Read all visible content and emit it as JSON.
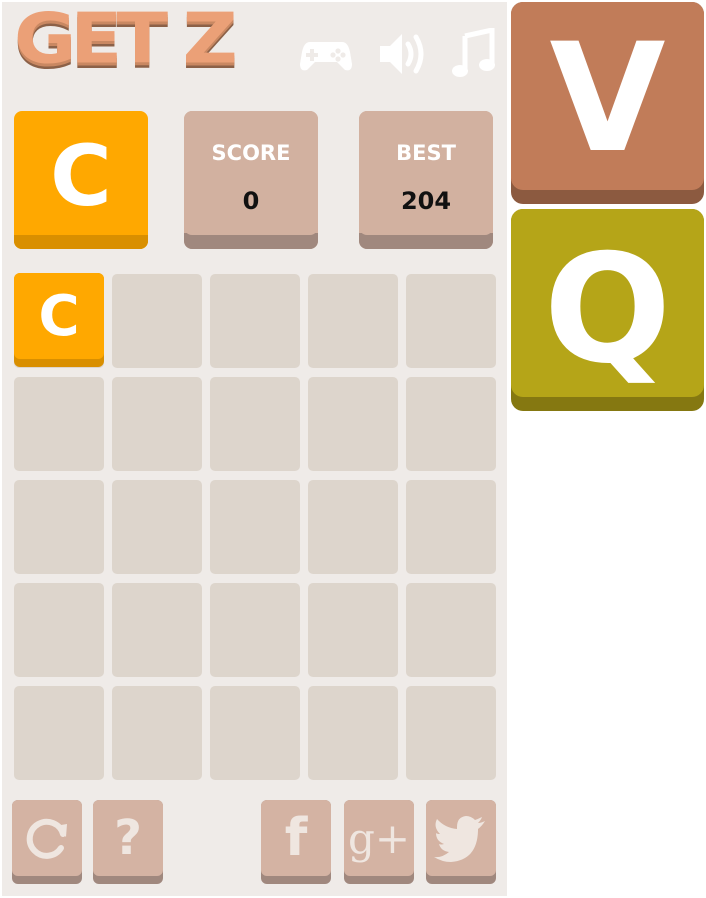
{
  "header": {
    "logo_text": "GET Z",
    "icons": [
      "gamepad-icon",
      "speaker-icon",
      "music-icon"
    ]
  },
  "current_tile": {
    "letter": "C",
    "color": "#ffa800"
  },
  "score": {
    "label": "SCORE",
    "value": "0"
  },
  "best": {
    "label": "BEST",
    "value": "204"
  },
  "board": {
    "rows": 5,
    "cols": 5,
    "tiles": [
      {
        "row": 0,
        "col": 0,
        "letter": "C",
        "color": "#ffa800"
      }
    ]
  },
  "footer_buttons": [
    "restart-icon",
    "help-icon",
    "facebook-icon",
    "google-plus-icon",
    "twitter-icon"
  ],
  "side_tiles": [
    {
      "letter": "V",
      "color": "#c17c59"
    },
    {
      "letter": "Q",
      "color": "#b5a518"
    }
  ],
  "help_glyph": "?",
  "facebook_glyph": "f",
  "gplus_glyph": "g+"
}
